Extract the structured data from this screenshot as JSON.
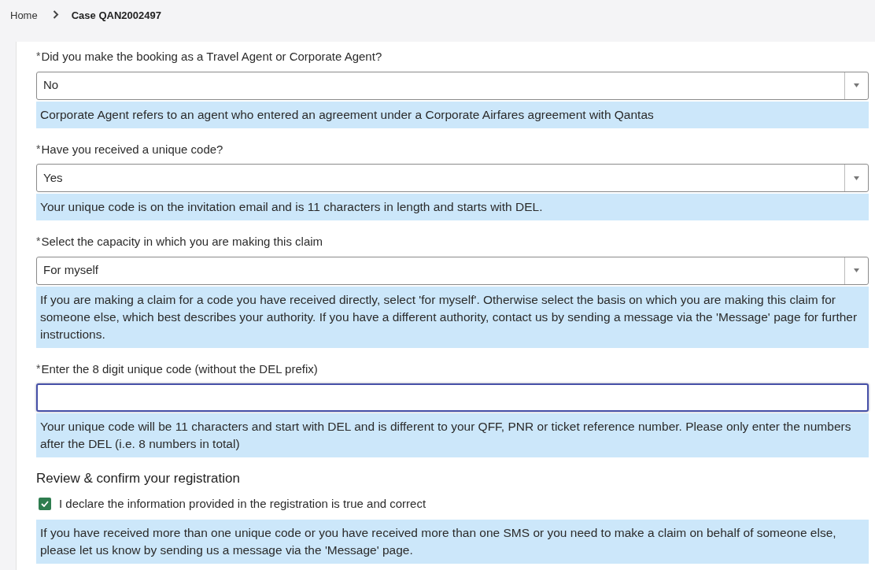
{
  "breadcrumb": {
    "home": "Home",
    "current": "Case QAN2002497"
  },
  "fields": [
    {
      "kind": "select",
      "marker": "*",
      "label": "Did you make the booking as a Travel Agent or Corporate Agent?",
      "value": "No",
      "help": "Corporate Agent refers to an agent who entered an agreement under a Corporate Airfares agreement with Qantas"
    },
    {
      "kind": "select",
      "marker": "*",
      "label": "Have you received a unique code?",
      "value": "Yes",
      "help": "Your unique code is on the invitation email and is 11 characters in length and starts with DEL."
    },
    {
      "kind": "select",
      "marker": "*",
      "label": "Select the capacity in which you are making this claim",
      "value": "For myself",
      "help": "If you are making a claim for a code you have received directly, select 'for myself'. Otherwise select the basis on which you are making this claim for someone else, which best describes your authority. If you have a different authority, contact us by sending a message via the 'Message' page for further instructions."
    },
    {
      "kind": "text",
      "marker": "*",
      "label": "Enter the 8 digit unique code (without the DEL prefix)",
      "focused": true,
      "help": "Your unique code will be 11 characters and start with DEL and is different to your QFF, PNR or ticket reference number. Please only enter the numbers after the DEL (i.e. 8 numbers in total)"
    }
  ],
  "review": {
    "heading": "Review & confirm your registration",
    "declaration": {
      "label": "I declare the information provided in the registration is true and correct",
      "checked": true
    },
    "help": "If you have received more than one unique code or you have received more than one SMS or you need to make a claim on behalf of someone else, please let us know by sending us a message via the 'Message' page."
  }
}
